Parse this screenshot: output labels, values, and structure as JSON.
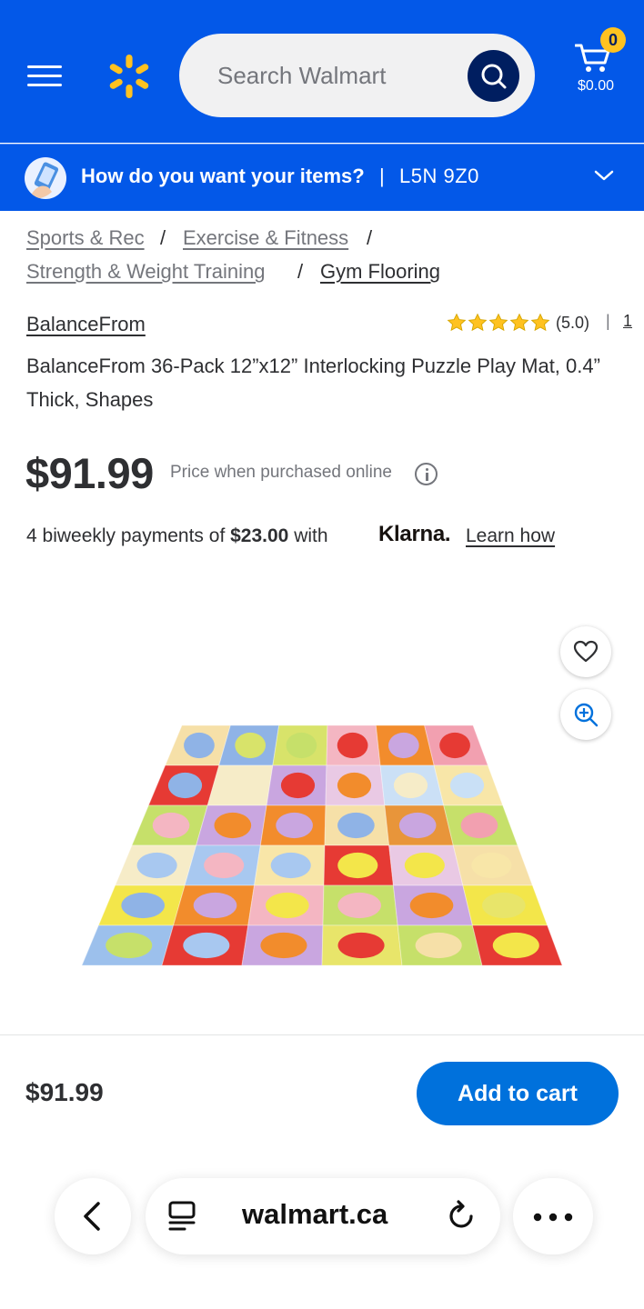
{
  "header": {
    "search_placeholder": "Search Walmart",
    "cart_count": "0",
    "cart_total": "$0.00"
  },
  "delivery": {
    "question": "How do you want your items?",
    "separator": "|",
    "postal_code": "L5N 9Z0"
  },
  "breadcrumb": {
    "items": [
      "Sports & Rec",
      "Exercise & Fitness",
      "Strength & Weight Training",
      "Gym Flooring"
    ],
    "separator": "/"
  },
  "product": {
    "brand": "BalanceFrom",
    "rating_value": "(5.0)",
    "rating_stars": 5,
    "rating_separator": "|",
    "review_count": "1",
    "title": "BalanceFrom 36-Pack 12”x12” Interlocking Puzzle Play Mat, 0.4” Thick, Shapes",
    "price": "$91.99",
    "price_note": "Price when purchased online",
    "klarna_prefix": "4 biweekly payments of",
    "klarna_amount": "$23.00",
    "klarna_with": "with",
    "klarna_brand": "Klarna.",
    "klarna_learn": "Learn how"
  },
  "bottom_bar": {
    "price": "$91.99",
    "add_to_cart": "Add to cart"
  },
  "browser": {
    "url": "walmart.ca"
  },
  "colors": {
    "brand_blue": "#0358e8",
    "spark_yellow": "#ffc220",
    "search_button": "#001e60",
    "add_to_cart": "#0071dc",
    "star": "#ffc220"
  },
  "icons": [
    "menu-icon",
    "walmart-spark-logo",
    "search-icon",
    "cart-icon",
    "delivery-icon",
    "chevron-down-icon",
    "star-icon",
    "info-icon",
    "heart-icon",
    "zoom-in-icon",
    "back-icon",
    "tabs-icon",
    "reload-icon",
    "more-icon"
  ]
}
